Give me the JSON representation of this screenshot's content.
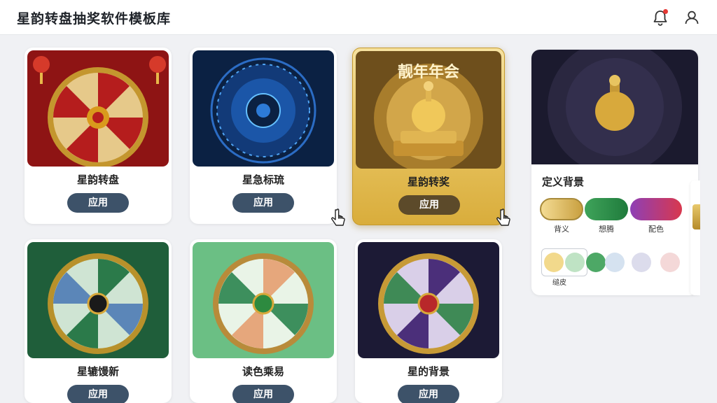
{
  "header": {
    "title": "星韵转盘抽奖软件模板库"
  },
  "templates": [
    {
      "name": "星韵转盘",
      "apply_label": "应用",
      "theme": "red"
    },
    {
      "name": "星急标琉",
      "apply_label": "应用",
      "theme": "blue"
    },
    {
      "name": "星韵转奖",
      "apply_label": "应用",
      "theme": "gold",
      "overlay_text": "靓年年会",
      "selected": true
    },
    {
      "name": "星辘馒新",
      "apply_label": "应用",
      "theme": "green"
    },
    {
      "name": "读色乘易",
      "apply_label": "应用",
      "theme": "mint"
    },
    {
      "name": "星的背景",
      "apply_label": "应用",
      "theme": "purple"
    }
  ],
  "customize_panel": {
    "title": "定义背景",
    "swatches": [
      {
        "label": "背义",
        "colors": [
          "#f4dc94",
          "#c9a040"
        ]
      },
      {
        "label": "想腾",
        "colors": [
          "#3fa35a",
          "#1f7b3c"
        ]
      },
      {
        "label": "配色",
        "colors": [
          "#8e3fb6",
          "#d8384e"
        ]
      }
    ],
    "dots_label": "缒皮",
    "dots": [
      "#f2d98c",
      "#bfe3c4",
      "#4da866",
      "#d5e2f0",
      "#dcdcec",
      "#f4d8d8"
    ]
  },
  "colors": {
    "apply_button": "#3d5269",
    "selected_apply_button": "#5c4a2a",
    "notification_dot": "#e53935"
  },
  "icons": [
    "bell-icon",
    "user-icon",
    "pointer-cursor-icon"
  ]
}
